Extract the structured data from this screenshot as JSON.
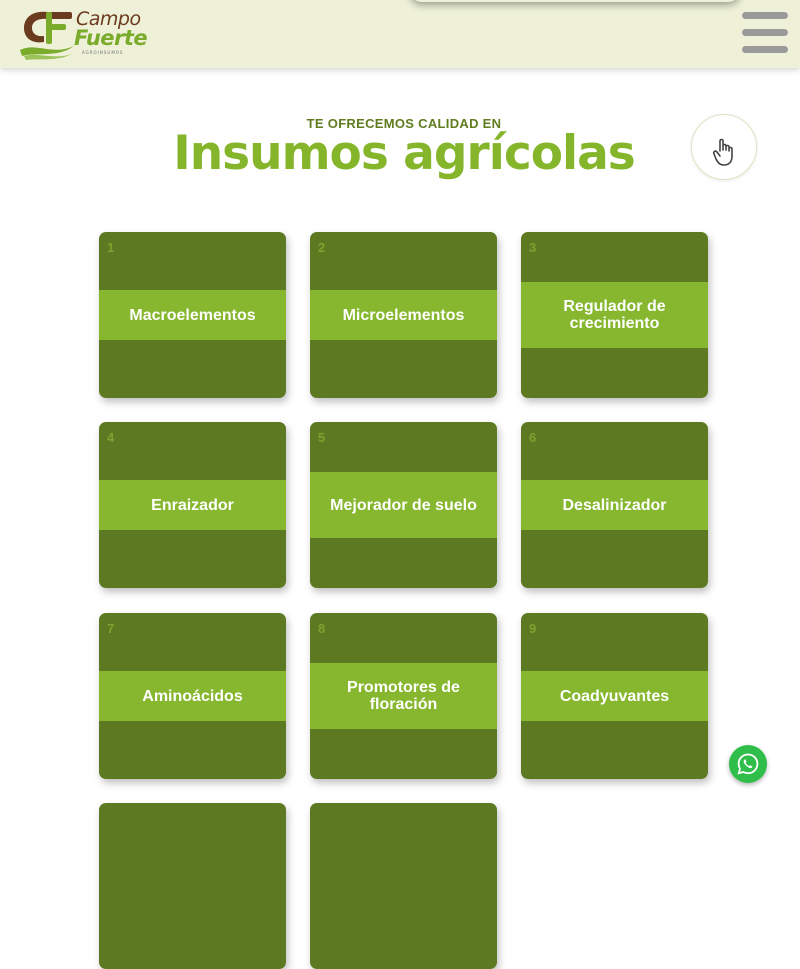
{
  "brand": {
    "name_top": "Campo",
    "name_bottom": "Fuerte",
    "tagline": "AGROINSUMOS",
    "colors": {
      "brown": "#6b3b1f",
      "green": "#7aab2a",
      "dark_green": "#5d7a22",
      "light_green": "#86b72f"
    }
  },
  "header": {
    "menu_icon": "hamburger-menu-icon"
  },
  "hero": {
    "kicker": "TE OFRECEMOS CALIDAD EN",
    "title": "Insumos agrícolas",
    "hand_icon": "pointer-hand-icon"
  },
  "products": [
    {
      "number": "1",
      "label": "Macroelementos"
    },
    {
      "number": "2",
      "label": "Microelementos"
    },
    {
      "number": "3",
      "label": "Regulador de crecimiento"
    },
    {
      "number": "4",
      "label": "Enraizador"
    },
    {
      "number": "5",
      "label": "Mejorador de suelo"
    },
    {
      "number": "6",
      "label": "Desalinizador"
    },
    {
      "number": "7",
      "label": "Aminoácidos"
    },
    {
      "number": "8",
      "label": "Promotores de floración"
    },
    {
      "number": "9",
      "label": "Coadyuvantes"
    }
  ],
  "whatsapp": {
    "icon": "whatsapp-icon"
  }
}
